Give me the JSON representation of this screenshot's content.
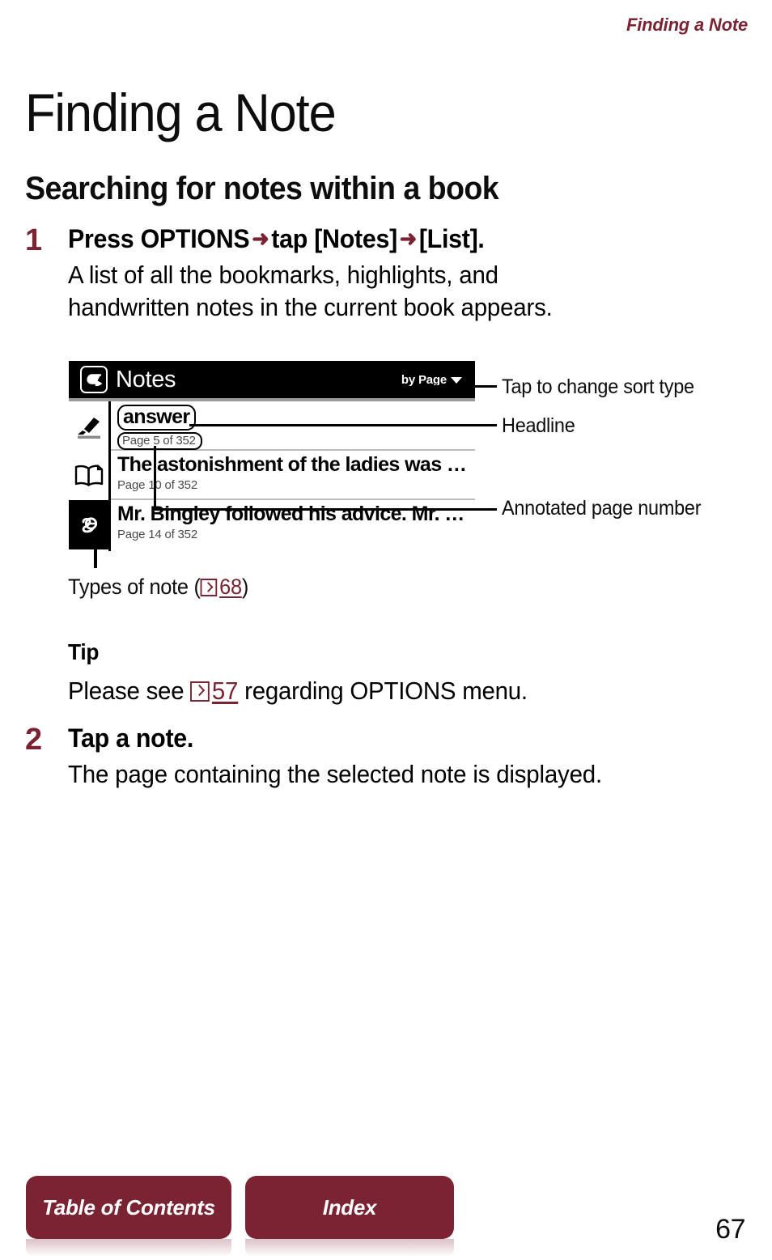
{
  "running_header": "Finding a Note",
  "page_title": "Finding a Note",
  "section_title": "Searching for notes within a book",
  "steps": [
    {
      "number": "1",
      "head_parts": {
        "p1": "Press OPTIONS",
        "arrow1": "➜",
        "p2": "tap [Notes]",
        "arrow2": "➜",
        "p3": "[List]."
      },
      "description_line1": "A list of all the bookmarks, highlights, and",
      "description_line2": "handwritten notes in the current book appears."
    },
    {
      "number": "2",
      "head": "Tap a note.",
      "description": "The page containing the selected note is displayed."
    }
  ],
  "device": {
    "back_icon": "back-arrow-icon",
    "title": "Notes",
    "sort_label": "by Page",
    "sort_caret": "▼",
    "note_type_icons": [
      {
        "name": "highlighter-icon",
        "selected": false
      },
      {
        "name": "bookmark-book-icon",
        "selected": false
      },
      {
        "name": "handwritten-note-icon",
        "selected": true
      }
    ],
    "rows": [
      {
        "title": "answer",
        "page": "Page 5 of 352",
        "highlighted": true
      },
      {
        "title": "The astonishment of the ladies was …",
        "page": "Page 10 of 352",
        "highlighted": false
      },
      {
        "title": "Mr. Bingley followed his advice. Mr. …",
        "page": "Page 14 of 352",
        "highlighted": false
      }
    ]
  },
  "callouts": {
    "sort": "Tap to change sort type",
    "headline": "Headline",
    "page_number": "Annotated page number"
  },
  "types_of_note": {
    "prefix": "Types of note (",
    "ref_icon": "reference-arrow-icon",
    "ref_page": "68",
    "suffix": ")"
  },
  "tip": {
    "heading": "Tip",
    "before": "Please see",
    "ref_icon": "reference-arrow-icon",
    "ref_page": "57",
    "after": "regarding OPTIONS menu."
  },
  "footer": {
    "table_of_contents": "Table of Contents",
    "index": "Index",
    "page_number": "67"
  },
  "colors": {
    "accent": "#7a2333",
    "text": "#0d0d0d",
    "device_bar": "#000000"
  }
}
